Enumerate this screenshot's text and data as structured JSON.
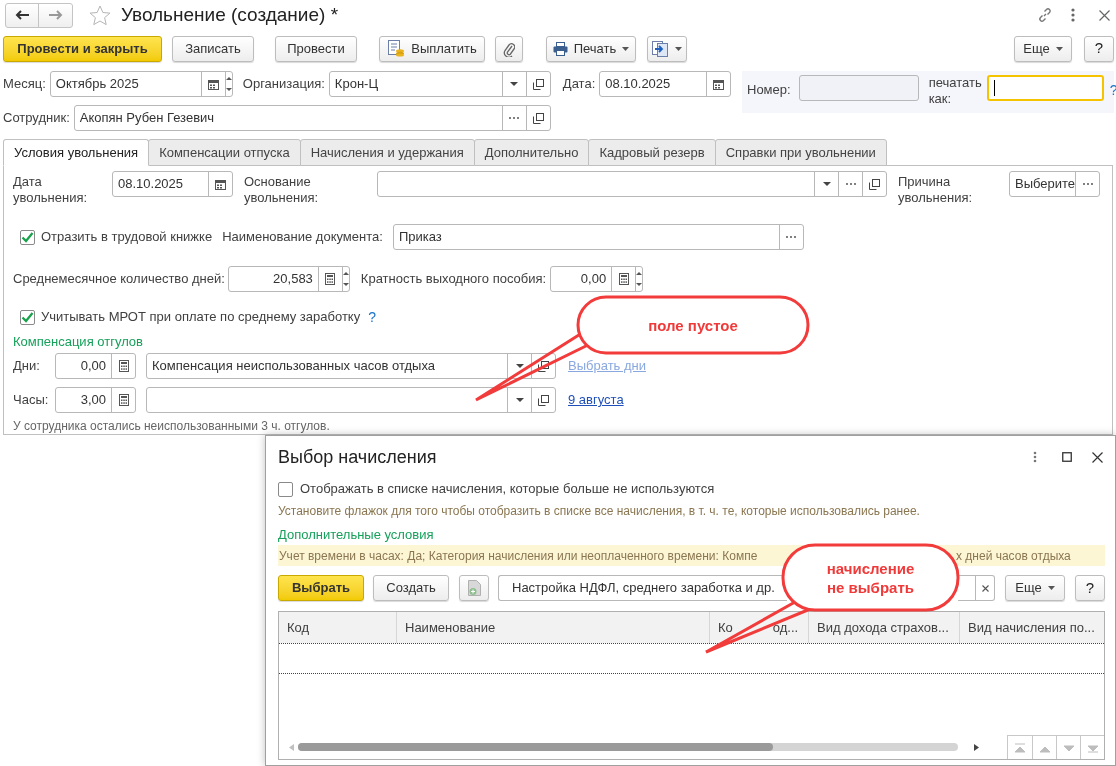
{
  "window": {
    "title": "Увольнение (создание) *"
  },
  "toolbar": {
    "buttons": [
      {
        "label": "Провести и закрыть",
        "kind": "primary"
      },
      {
        "label": "Записать",
        "kind": "plain"
      },
      {
        "label": "Провести",
        "kind": "plain"
      },
      {
        "label": "Выплатить",
        "kind": "pay"
      },
      {
        "kind": "attach"
      },
      {
        "label": "Печать",
        "kind": "print"
      },
      {
        "kind": "export"
      }
    ],
    "right": [
      {
        "label": "Еще",
        "kind": "menu"
      },
      {
        "label": "?",
        "kind": "help"
      }
    ]
  },
  "month": {
    "label": "Месяц:",
    "value": "Октябрь 2025"
  },
  "organization": {
    "label": "Организация:",
    "value": "Крон-Ц"
  },
  "date": {
    "label": "Дата:",
    "value": "08.10.2025"
  },
  "number": {
    "label": "Номер:",
    "disabled": true
  },
  "print_as": {
    "label": "печатать как:",
    "focused": true,
    "help": "?"
  },
  "employee": {
    "label": "Сотрудник:",
    "value": "Акопян Рубен Гезевич"
  },
  "tabs": [
    {
      "label": "Условия увольнения",
      "selected": true
    },
    {
      "label": "Компенсации отпуска",
      "selected": false
    },
    {
      "label": "Начисления и удержания",
      "selected": false
    },
    {
      "label": "Дополнительно",
      "selected": false
    },
    {
      "label": "Кадровый резерв",
      "selected": false
    },
    {
      "label": "Справки при увольнении",
      "selected": false
    }
  ],
  "dismissal_date": {
    "label": "Дата увольнения:",
    "value": "08.10.2025"
  },
  "basis": {
    "label": "Основание увольнения:"
  },
  "reason": {
    "label": "Причина увольнения:",
    "value": "Выберите"
  },
  "work_book": {
    "label": "Отразить в трудовой книжке",
    "checked": true
  },
  "document_name": {
    "label": "Наименование документа:",
    "value": "Приказ"
  },
  "avg_days": {
    "label": "Среднемесячное количество дней:",
    "value": "20,583"
  },
  "severance": {
    "label": "Кратность выходного пособия:",
    "value": "0,00"
  },
  "mrot": {
    "label": "Учитывать МРОТ при оплате по среднему заработку",
    "checked": true,
    "help": "?"
  },
  "time_off": {
    "title": "Компенсация отгулов",
    "rows": [
      {
        "label": "Дни:",
        "amount": "0,00",
        "accrual": "Компенсация неиспользованных часов отдыха",
        "link": "Выбрать дни",
        "link_disabled": true
      },
      {
        "label": "Часы:",
        "amount": "3,00",
        "link": "9 августа",
        "link_disabled": false
      }
    ],
    "note": "У сотрудника остались неиспользованными 3 ч. отгулов."
  },
  "dialog": {
    "title": "Выбор начисления",
    "show_unused": {
      "label": "Отображать в списке начисления, которые больше не используются",
      "checked": false
    },
    "hint": "Установите флажок для того чтобы отобразить в списке все начисления, в т. ч. те, которые использовались ранее.",
    "conditions_title": "Дополнительные условия",
    "conditions": [
      "Учет времени в часах: Да; Категория начисления или неоплаченного времени: Компе",
      "х дней часов отдыха"
    ],
    "buttons": [
      {
        "label": "Выбрать",
        "kind": "primary"
      },
      {
        "label": "Создать",
        "kind": "plain"
      },
      {
        "kind": "copy"
      }
    ],
    "search": {
      "value": "Настройка НДФЛ, среднего заработка и др."
    },
    "more": "Еще",
    "help": "?",
    "table": {
      "columns": [
        {
          "label": "Код"
        },
        {
          "label": "Наименование"
        },
        {
          "label": "Ко",
          "after": "од..."
        },
        {
          "label": "Вид дохода страхов..."
        },
        {
          "label": "Вид начисления по..."
        }
      ]
    }
  },
  "annotations": [
    {
      "lines": [
        "поле пустое"
      ]
    },
    {
      "lines": [
        "начисление",
        "не выбрать"
      ]
    }
  ]
}
